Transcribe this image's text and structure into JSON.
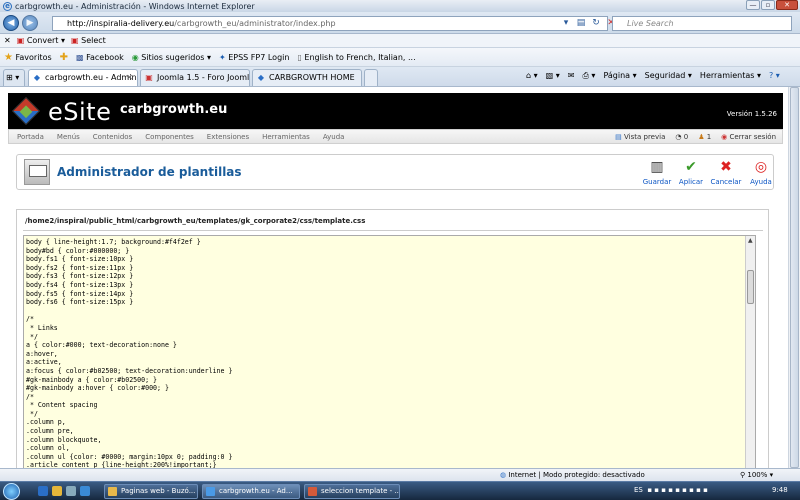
{
  "window": {
    "title": "carbgrowth.eu - Administración - Windows Internet Explorer",
    "controls": [
      "—",
      "▫",
      "✕"
    ]
  },
  "addressbar": {
    "url_host": "http://inspiralia-delivery.eu",
    "url_path": "/carbgrowth_eu/administrator/index.php",
    "search_placeholder": "Live Search"
  },
  "convertbar": {
    "close": "✕",
    "convert": "Convert",
    "select": "Select"
  },
  "favoritesbar": {
    "favorites": "Favoritos",
    "items": [
      "Facebook",
      "Sitios sugeridos ▾",
      "EPSS FP7 Login",
      "English to French, Italian, ..."
    ]
  },
  "tabs": [
    {
      "label": "carbgrowth.eu - Admin...",
      "close": "✕"
    },
    {
      "label": "Joomla 1.5 - Foro Joomla ..."
    },
    {
      "label": "CARBGROWTH HOME"
    }
  ],
  "commandbar": {
    "pagina": "Página ▾",
    "seguridad": "Seguridad ▾",
    "herramientas": "Herramientas ▾",
    "help": "? ▾"
  },
  "joomla": {
    "brand": "eSite",
    "site": "carbgrowth.eu",
    "version": "Versión 1.5.26",
    "menu": [
      "Portada",
      "Menús",
      "Contenidos",
      "Componentes",
      "Extensiones",
      "Herramientas",
      "Ayuda"
    ],
    "right": {
      "preview": "Vista previa",
      "msg_count": "0",
      "users_count": "1",
      "logout": "Cerrar sesión"
    },
    "page_title": "Administrador de plantillas",
    "toolbar": {
      "save": "Guardar",
      "apply": "Aplicar",
      "cancel": "Cancelar",
      "help": "Ayuda"
    },
    "file_path": "/home2/inspiral/public_html/carbgrowth_eu/templates/gk_corporate2/css/template.css",
    "code_lines": [
      "body { line-height:1.7; background:#f4f2ef }",
      "body#bd { color:#000000; }",
      "body.fs1 { font-size:10px }",
      "body.fs2 { font-size:11px }",
      "body.fs3 { font-size:12px }",
      "body.fs4 { font-size:13px }",
      "body.fs5 { font-size:14px }",
      "body.fs6 { font-size:15px }",
      "",
      "/*",
      " * Links",
      " */",
      "a { color:#000; text-decoration:none }",
      "a:hover,",
      "a:active,",
      "a:focus { color:#b02500; text-decoration:underline }",
      "#gk-mainbody a { color:#b02500; }",
      "#gk-mainbody a:hover { color:#000; }",
      "/*",
      " * Content spacing",
      " */",
      ".column p,",
      ".column pre,",
      ".column blockquote,",
      ".column ol,",
      ".column ul {color: #0000; margin:10px 0; padding:0 }",
      ".article_content p {line-height:200%!important;}"
    ]
  },
  "statusbar": {
    "zone": "Internet | Modo protegido: desactivado",
    "zoom": "100%"
  },
  "taskbar": {
    "apps": [
      "Paginas web - Buzó...",
      "carbgrowth.eu - Ad...",
      "seleccion template - ..."
    ],
    "lang": "ES",
    "clock": "9:48"
  }
}
